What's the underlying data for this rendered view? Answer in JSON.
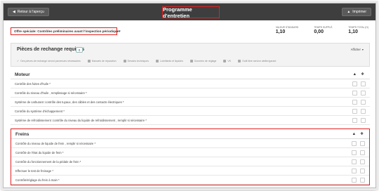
{
  "header": {
    "back_label": "Retour à l'aperçu",
    "title": "Programme d'entretien",
    "print_label": "Imprimer"
  },
  "offer": {
    "selected": "Offre spéciale: Contrôles préliminaires avant l'inspection périodique"
  },
  "stats": [
    {
      "label": "Valeur standard",
      "value": "1,10"
    },
    {
      "label": "Temps supplé.",
      "value": "0,00"
    },
    {
      "label": "Temps total (h)",
      "value": "1,10"
    }
  ],
  "parts": {
    "title": "Pièces de rechange requises",
    "count": "0",
    "show_label": "Afficher",
    "tools": [
      {
        "label": "Des pièces de rechange seront parvenues nécessaires",
        "icon": "check-icon"
      },
      {
        "label": "Manuels de réparation",
        "icon": "manual-icon"
      },
      {
        "label": "Dessins techniques",
        "icon": "drawing-icon"
      },
      {
        "label": "Lubrifiants et liquides",
        "icon": "drop-icon"
      },
      {
        "label": "Données de réglage",
        "icon": "settings-icon"
      },
      {
        "label": "VK",
        "icon": "vk-icon"
      },
      {
        "label": "Outil libre service atelier/garant",
        "icon": "tool-icon"
      }
    ]
  },
  "sections": [
    {
      "title": "Moteur",
      "rows": [
        "Contrôle des fuites d'huile",
        "Contrôle du niveau d'huile , remplissage si nécessaire",
        "Système de carburant :contrôle des tuyaux, des câbles et des contacts électriques",
        "Contrôle du système d'échappement",
        "Système de refroidissement :contrôle du niveau du liquide de refroidissement , remplir si nécessaire"
      ]
    },
    {
      "title": "Freins",
      "rows": [
        "Contrôle du niveau de liquide de frein , remplir si nécessaire",
        "Contrôle de l'état du liquide de frein",
        "Contrôle du fonctionnement de la pédale de frein",
        "Effectuer le test de freinage",
        "Contrôle/réglage du frein à main"
      ]
    }
  ],
  "required_mark": "*"
}
